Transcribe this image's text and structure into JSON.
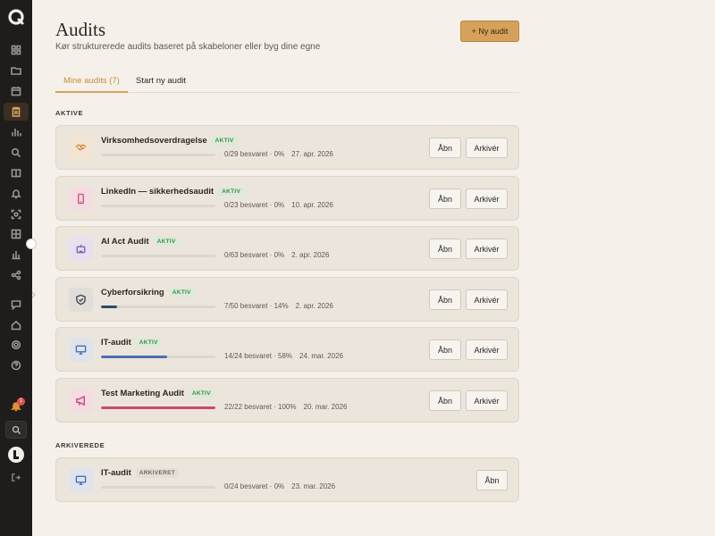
{
  "header": {
    "title": "Audits",
    "subtitle": "Kør strukturerede audits baseret på skabeloner eller byg dine egne",
    "new_button": "+ Ny audit"
  },
  "tabs": [
    {
      "label": "Mine audits (7)",
      "active": true
    },
    {
      "label": "Start ny audit",
      "active": false
    }
  ],
  "sections": {
    "active": "AKTIVE",
    "archived": "ARKIVEREDE"
  },
  "buttons": {
    "open": "Åbn",
    "archive": "Arkivér"
  },
  "active_audits": [
    {
      "title": "Virksomhedsoverdragelse",
      "status": "AKTIV",
      "progress_text": "0/29 besvaret · 0%",
      "progress": 0,
      "date": "27. apr. 2026",
      "icon": "handshake-icon",
      "icon_bg": "#f3e4d3",
      "icon_color": "#d08a3c",
      "bar_color": "#3c5a85"
    },
    {
      "title": "LinkedIn — sikkerhedsaudit",
      "status": "AKTIV",
      "progress_text": "0/23 besvaret · 0%",
      "progress": 0,
      "date": "10. apr. 2026",
      "icon": "phone-icon",
      "icon_bg": "#f5dce2",
      "icon_color": "#d0567a",
      "bar_color": "#3c5a85"
    },
    {
      "title": "AI Act Audit",
      "status": "AKTIV",
      "progress_text": "0/63 besvaret · 0%",
      "progress": 0,
      "date": "2. apr. 2026",
      "icon": "robot-icon",
      "icon_bg": "#e6e0ef",
      "icon_color": "#7a68b3",
      "bar_color": "#3c5a85"
    },
    {
      "title": "Cyberforsikring",
      "status": "AKTIV",
      "progress_text": "7/50 besvaret · 14%",
      "progress": 0.14,
      "date": "2. apr. 2026",
      "icon": "shield-icon",
      "icon_bg": "#e1ddd8",
      "icon_color": "#3d4a57",
      "bar_color": "#2f4a6b"
    },
    {
      "title": "IT-audit",
      "status": "AKTIV",
      "progress_text": "14/24 besvaret · 58%",
      "progress": 0.58,
      "date": "24. mar. 2026",
      "icon": "monitor-icon",
      "icon_bg": "#dfe3ec",
      "icon_color": "#4a6fb3",
      "bar_color": "#4a6fb3"
    },
    {
      "title": "Test Marketing Audit",
      "status": "AKTIV",
      "progress_text": "22/22 besvaret · 100%",
      "progress": 1,
      "date": "20. mar. 2026",
      "icon": "megaphone-icon",
      "icon_bg": "#f5dce2",
      "icon_color": "#c94a6e",
      "bar_color": "#c94a6e"
    }
  ],
  "archived_audits": [
    {
      "title": "IT-audit",
      "status": "ARKIVERET",
      "progress_text": "0/24 besvaret · 0%",
      "progress": 0,
      "date": "23. mar. 2026",
      "icon": "monitor-icon",
      "icon_bg": "#dfe3ec",
      "icon_color": "#4a6fb3",
      "bar_color": "#4a6fb3"
    }
  ],
  "sidebar": {
    "icons": [
      "dashboard-icon",
      "folder-icon",
      "calendar-icon",
      "clipboard-icon",
      "bar-chart-icon",
      "search-icon",
      "book-icon",
      "alert-icon",
      "scan-icon",
      "grid-icon",
      "building-chart-icon",
      "share-icon",
      "chat-icon",
      "home-icon",
      "settings-icon",
      "help-icon"
    ],
    "notification_count": "1"
  }
}
